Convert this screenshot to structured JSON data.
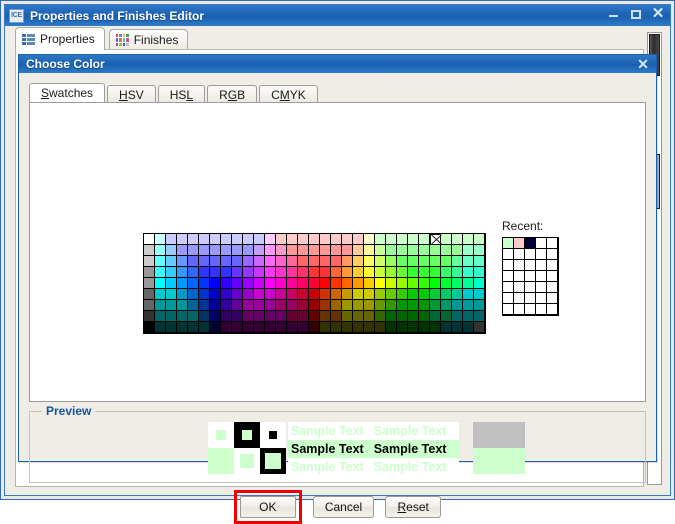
{
  "app": {
    "title": "Properties and Finishes Editor",
    "icon_name": "ice-app-icon",
    "icon_text": "ICE",
    "window_buttons": {
      "minimize": "minimize-icon",
      "maximize": "maximize-icon",
      "close": "✕"
    },
    "tabs": [
      {
        "label": "Properties",
        "icon": "list-icon",
        "active": true
      },
      {
        "label": "Finishes",
        "icon": "color-grid-icon",
        "active": false
      }
    ]
  },
  "dialog": {
    "title": "Choose Color",
    "close_label": "✕",
    "tabs": [
      {
        "label": "Swatches",
        "mnemonic": "S",
        "active": true
      },
      {
        "label": "HSV",
        "mnemonic": "H",
        "active": false
      },
      {
        "label": "HSL",
        "mnemonic": "L",
        "active": false
      },
      {
        "label": "RGB",
        "mnemonic": "G",
        "active": false
      },
      {
        "label": "CMYK",
        "mnemonic": "M",
        "active": false
      }
    ],
    "recent": {
      "label": "Recent:",
      "colors": [
        "#ccffcc",
        "#ffcccc",
        "#000033"
      ],
      "columns": 5,
      "rows": 7,
      "empty_color": "#ffffff"
    },
    "swatches": {
      "columns": 31,
      "rows": 9,
      "cursor": {
        "col": 26,
        "row": 0,
        "marker": "crosshair-cursor"
      }
    },
    "preview": {
      "legend": "Preview",
      "selected_color": "#ccffcc",
      "sample_text": "Sample Text",
      "text_rows": [
        {
          "fg": "#ccffcc",
          "bg": "#ffffff"
        },
        {
          "fg": "#000000",
          "bg": "#ccffcc"
        },
        {
          "fg": "#ccffcc",
          "bg": "#ffffff"
        }
      ],
      "blocks": [
        {
          "color": "#c0c0c0",
          "name": "gray-preview-block"
        },
        {
          "color": "#ccffcc",
          "name": "selected-preview-block"
        }
      ]
    },
    "buttons": [
      {
        "label": "OK",
        "mnemonic": "",
        "highlighted": true
      },
      {
        "label": "Cancel",
        "mnemonic": "",
        "highlighted": false
      },
      {
        "label": "Reset",
        "mnemonic": "R",
        "highlighted": false
      }
    ],
    "highlight_color": "#ee0000"
  },
  "colors": {
    "titlebar_blue": "#1c63b4",
    "dialog_border": "#1a5fb0",
    "panel_bg": "#f0ede6",
    "legend_blue": "#1456a0",
    "selected_swatch": "#ccffcc"
  }
}
